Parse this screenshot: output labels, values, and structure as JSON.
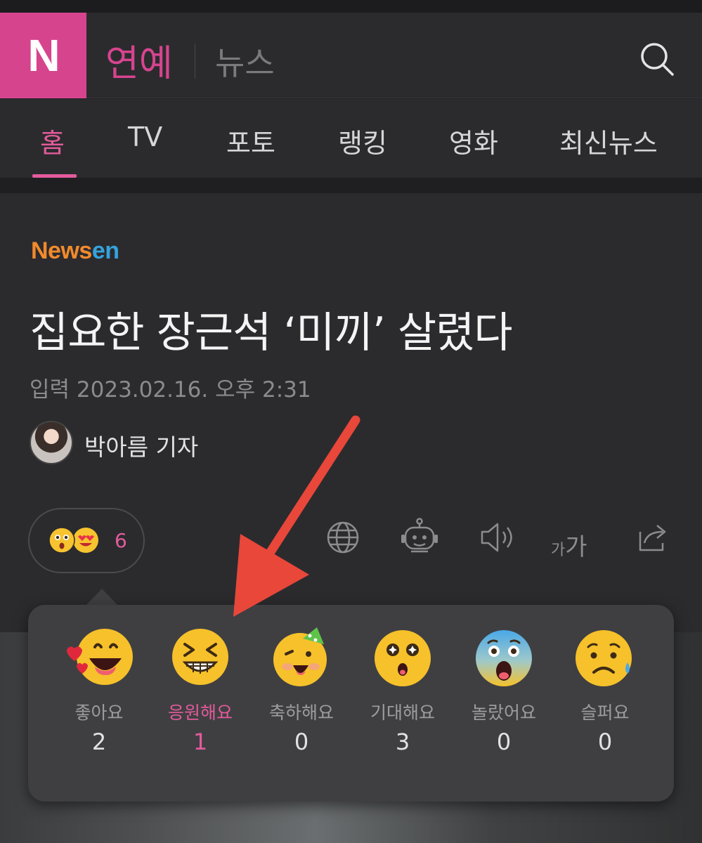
{
  "header": {
    "logo_letter": "N",
    "brand": "연예",
    "sub": "뉴스"
  },
  "nav": {
    "tabs": [
      "홈",
      "TV",
      "포토",
      "랭킹",
      "영화",
      "최신뉴스"
    ],
    "active_index": 0
  },
  "article": {
    "source_part1": "News",
    "source_part2": "en",
    "title": "집요한 장근석 ‘미끼’ 살렸다",
    "date": "입력 2023.02.16. 오후 2:31",
    "reporter": "박아름 기자"
  },
  "reaction_summary": {
    "count": "6"
  },
  "tools": {
    "font_size_label_small": "가",
    "font_size_label_large": "가"
  },
  "reactions": [
    {
      "label": "좋아요",
      "count": "2",
      "selected": false
    },
    {
      "label": "응원해요",
      "count": "1",
      "selected": true
    },
    {
      "label": "축하해요",
      "count": "0",
      "selected": false
    },
    {
      "label": "기대해요",
      "count": "3",
      "selected": false
    },
    {
      "label": "놀랐어요",
      "count": "0",
      "selected": false
    },
    {
      "label": "슬퍼요",
      "count": "0",
      "selected": false
    }
  ],
  "colors": {
    "accent": "#e35b9c",
    "logo_bg": "#d6448e",
    "background": "#2b2b2e",
    "annotation_arrow": "#e8473a"
  }
}
